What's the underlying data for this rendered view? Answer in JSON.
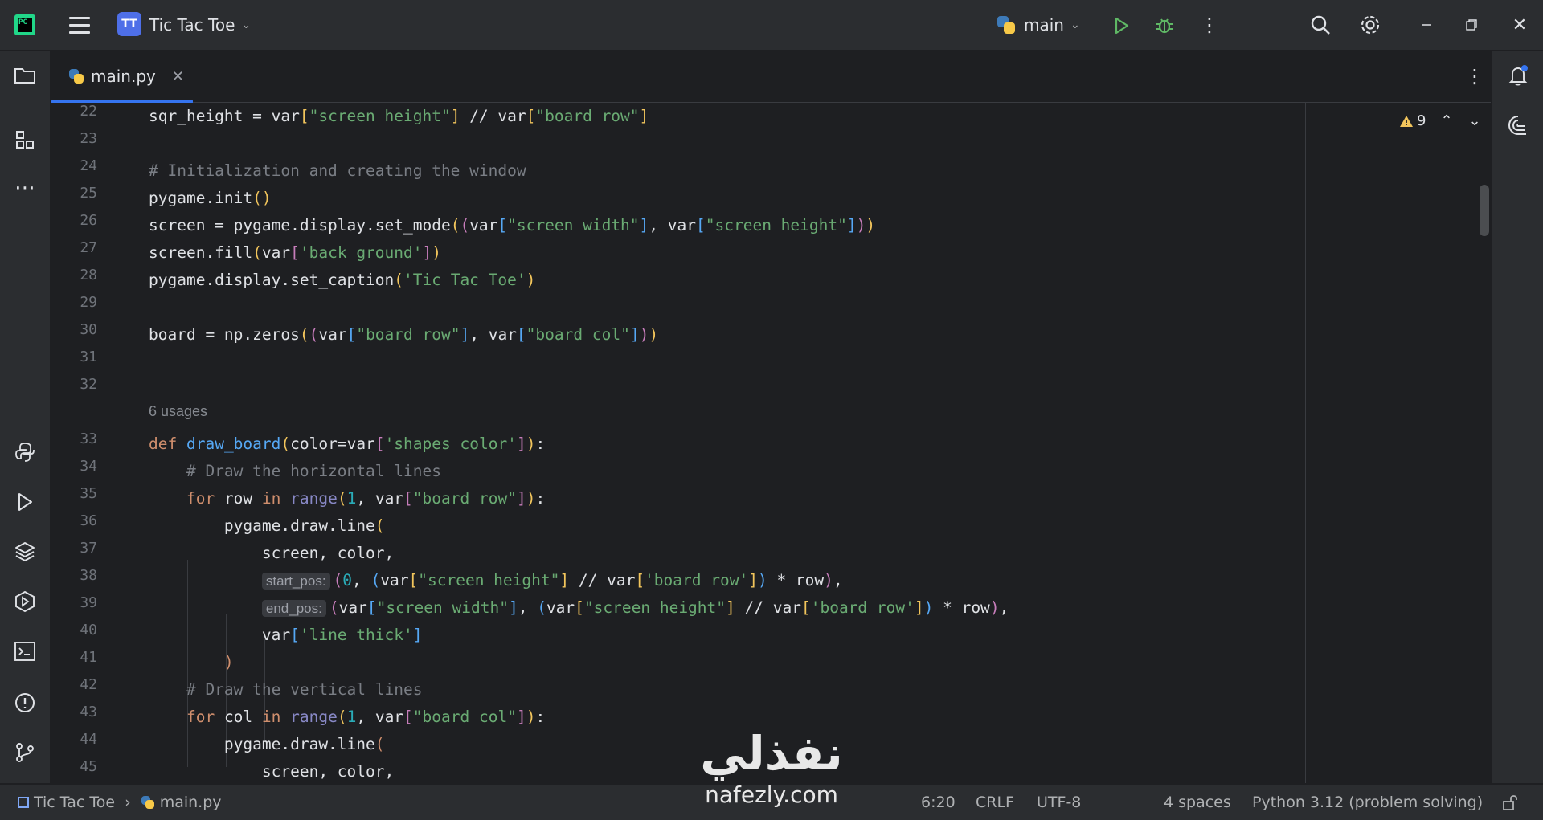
{
  "titlebar": {
    "project_badge": "TT",
    "project_name": "Tic Tac Toe",
    "run_config": "main"
  },
  "tabs": [
    {
      "label": "main.py",
      "active": true
    }
  ],
  "editor": {
    "warnings_count": "9",
    "lines": [
      {
        "n": "22",
        "code": "sqr_height = var[\"screen height\"] // var[\"board row\"]"
      },
      {
        "n": "23",
        "code": ""
      },
      {
        "n": "24",
        "code": "# Initialization and creating the window"
      },
      {
        "n": "25",
        "code": "pygame.init()"
      },
      {
        "n": "26",
        "code": "screen = pygame.display.set_mode((var[\"screen width\"], var[\"screen height\"]))"
      },
      {
        "n": "27",
        "code": "screen.fill(var['back ground'])"
      },
      {
        "n": "28",
        "code": "pygame.display.set_caption('Tic Tac Toe')"
      },
      {
        "n": "29",
        "code": ""
      },
      {
        "n": "30",
        "code": "board = np.zeros((var[\"board row\"], var[\"board col\"]))"
      },
      {
        "n": "31",
        "code": ""
      },
      {
        "n": "32",
        "code": ""
      },
      {
        "n": "33",
        "code": "def draw_board(color=var['shapes color']):"
      },
      {
        "n": "34",
        "code": "    # Draw the horizontal lines"
      },
      {
        "n": "35",
        "code": "    for row in range(1, var[\"board row\"]):"
      },
      {
        "n": "36",
        "code": "        pygame.draw.line("
      },
      {
        "n": "37",
        "code": "            screen, color,"
      },
      {
        "n": "38",
        "code": "            (0, (var[\"screen height\"] // var['board row']) * row),"
      },
      {
        "n": "39",
        "code": "            (var[\"screen width\"], (var[\"screen height\"] // var['board row']) * row),"
      },
      {
        "n": "40",
        "code": "            var['line thick']"
      },
      {
        "n": "41",
        "code": "        )"
      },
      {
        "n": "42",
        "code": "    # Draw the vertical lines"
      },
      {
        "n": "43",
        "code": "    for col in range(1, var[\"board col\"]):"
      },
      {
        "n": "44",
        "code": "        pygame.draw.line("
      },
      {
        "n": "45",
        "code": "            screen, color,"
      }
    ],
    "usages_label": "6 usages",
    "hint_start": "start_pos:",
    "hint_end": "end_pos:"
  },
  "statusbar": {
    "breadcrumb_project": "Tic Tac Toe",
    "breadcrumb_file": "main.py",
    "position": "6:20",
    "line_ending": "CRLF",
    "encoding": "UTF-8",
    "indent": "4 spaces",
    "interpreter": "Python 3.12 (problem solving)"
  },
  "watermark": {
    "arabic": "نفذلي",
    "latin": "nafezly.com"
  },
  "colors": {
    "accent": "#3574f0",
    "run_green": "#5fb865",
    "keyword": "#cf8e6d",
    "string": "#6aab73",
    "comment": "#7a7e85",
    "function": "#56a8f5"
  },
  "icons": [
    "pycharm-logo-icon",
    "hamburger-menu-icon",
    "chevron-down-icon",
    "python-icon",
    "run-icon",
    "debug-icon",
    "more-vertical-icon",
    "search-icon",
    "gear-icon",
    "minimize-icon",
    "restore-icon",
    "close-icon",
    "folder-icon",
    "structure-icon",
    "more-horizontal-icon",
    "python-console-icon",
    "run-tool-icon",
    "layers-icon",
    "services-icon",
    "terminal-icon",
    "problems-icon",
    "git-icon",
    "notifications-icon",
    "ai-assistant-icon",
    "warning-icon",
    "chevron-up-icon",
    "lock-icon"
  ]
}
